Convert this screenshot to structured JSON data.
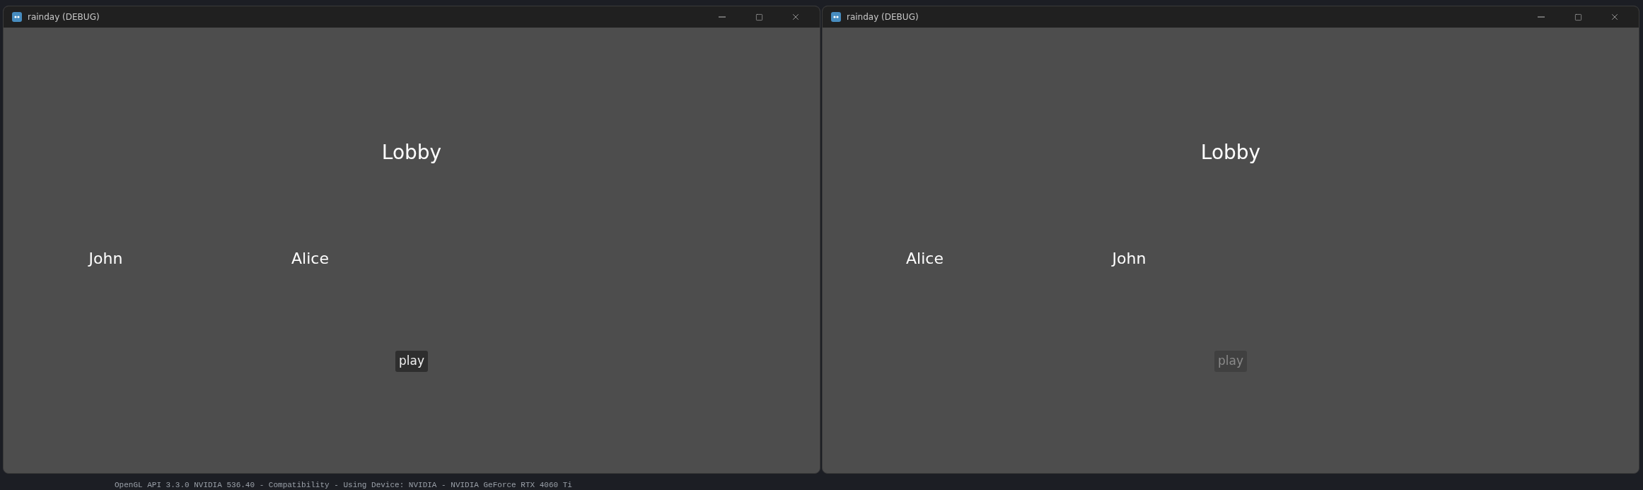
{
  "windows": [
    {
      "title": "rainday (DEBUG)",
      "heading": "Lobby",
      "players": [
        "John",
        "Alice"
      ],
      "play": {
        "label": "play",
        "disabled": false
      }
    },
    {
      "title": "rainday (DEBUG)",
      "heading": "Lobby",
      "players": [
        "Alice",
        "John"
      ],
      "play": {
        "label": "play",
        "disabled": true
      }
    }
  ],
  "console_line": "OpenGL API 3.3.0 NVIDIA 536.40 - Compatibility - Using Device: NVIDIA - NVIDIA GeForce RTX 4060 Ti"
}
